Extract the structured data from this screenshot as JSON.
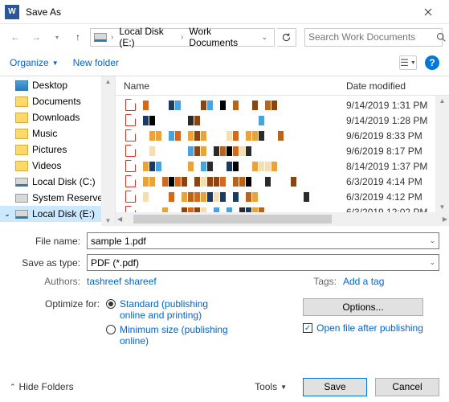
{
  "title": "Save As",
  "breadcrumb": {
    "seg1": "Local Disk (E:)",
    "seg2": "Work Documents"
  },
  "search": {
    "placeholder": "Search Work Documents"
  },
  "toolbar": {
    "organize": "Organize",
    "new_folder": "New folder"
  },
  "tree": {
    "items": [
      {
        "label": "Desktop",
        "type": "desktop"
      },
      {
        "label": "Documents",
        "type": "folder"
      },
      {
        "label": "Downloads",
        "type": "folder"
      },
      {
        "label": "Music",
        "type": "folder"
      },
      {
        "label": "Pictures",
        "type": "folder"
      },
      {
        "label": "Videos",
        "type": "folder"
      },
      {
        "label": "Local Disk (C:)",
        "type": "drive"
      },
      {
        "label": "System Reserved",
        "type": "system"
      },
      {
        "label": "Local Disk (E:)",
        "type": "drive",
        "selected": true
      }
    ]
  },
  "columns": {
    "name": "Name",
    "date": "Date modified"
  },
  "files": [
    {
      "date": "9/14/2019 1:31 PM"
    },
    {
      "date": "9/14/2019 1:28 PM"
    },
    {
      "date": "9/6/2019 8:33 PM"
    },
    {
      "date": "9/6/2019 8:17 PM"
    },
    {
      "date": "8/14/2019 1:37 PM"
    },
    {
      "date": "6/3/2019 4:14 PM"
    },
    {
      "date": "6/3/2019 4:12 PM"
    },
    {
      "date": "6/3/2019 12:02 PM"
    }
  ],
  "form": {
    "file_name_label": "File name:",
    "file_name_value": "sample 1.pdf",
    "save_type_label": "Save as type:",
    "save_type_value": "PDF (*.pdf)",
    "authors_label": "Authors:",
    "authors_value": "tashreef shareef",
    "tags_label": "Tags:",
    "tags_value": "Add a tag",
    "optimize_label": "Optimize for:",
    "opt_standard": "Standard (publishing online and printing)",
    "opt_minimum": "Minimum size (publishing online)",
    "options_btn": "Options...",
    "open_after": "Open file after publishing"
  },
  "footer": {
    "hide_folders": "Hide Folders",
    "tools": "Tools",
    "save": "Save",
    "cancel": "Cancel"
  }
}
